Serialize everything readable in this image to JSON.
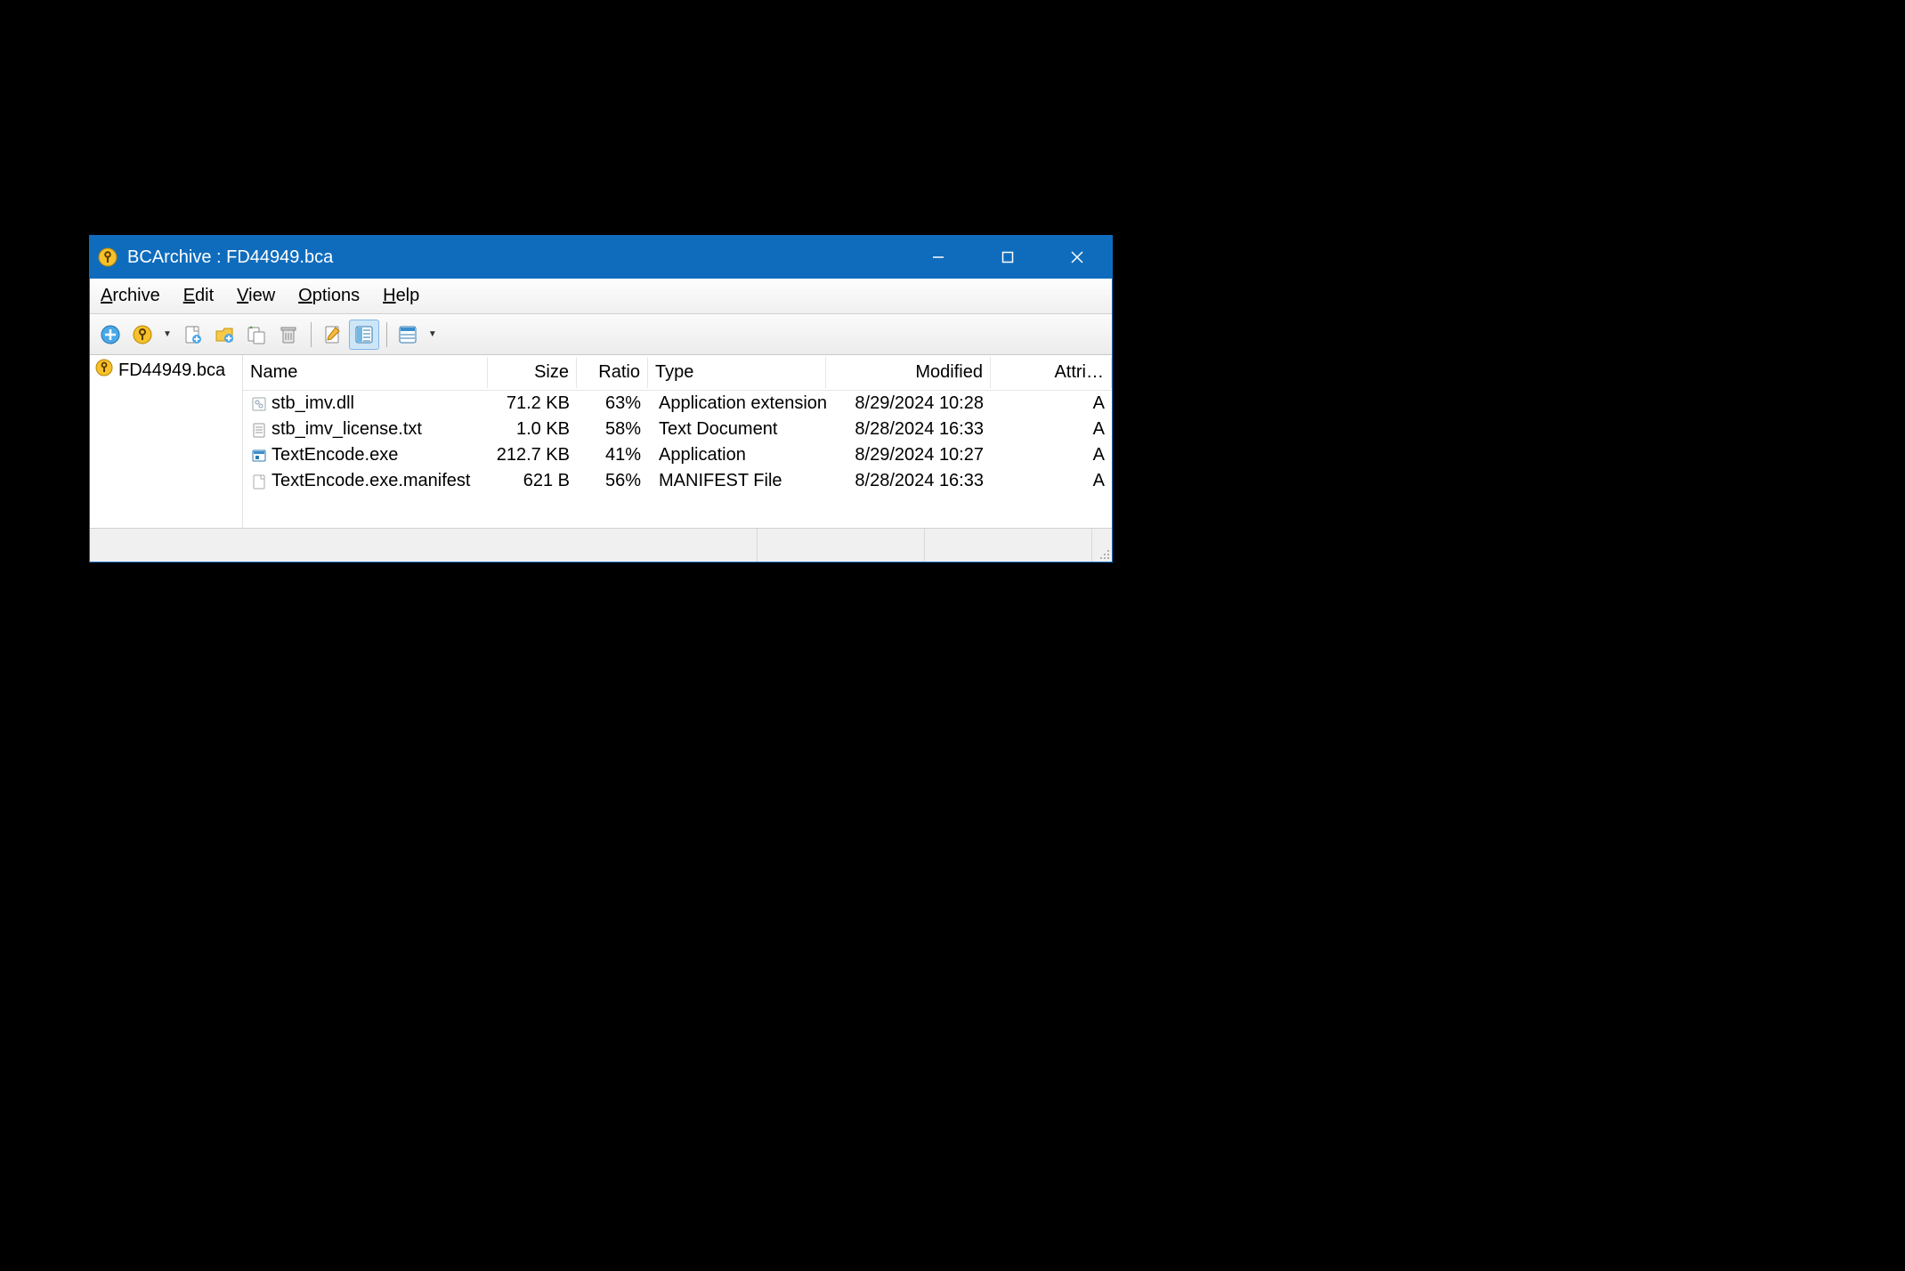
{
  "window": {
    "title": "BCArchive : FD44949.bca"
  },
  "menus": [
    {
      "label": "Archive",
      "hotkey": "A"
    },
    {
      "label": "Edit",
      "hotkey": "E"
    },
    {
      "label": "View",
      "hotkey": "V"
    },
    {
      "label": "Options",
      "hotkey": "O"
    },
    {
      "label": "Help",
      "hotkey": "H"
    }
  ],
  "tree": {
    "root": "FD44949.bca"
  },
  "columns": {
    "name": "Name",
    "size": "Size",
    "ratio": "Ratio",
    "type": "Type",
    "modified": "Modified",
    "attr": "Attri…"
  },
  "files": [
    {
      "icon": "dll",
      "name": "stb_imv.dll",
      "size": "71.2 KB",
      "ratio": "63%",
      "type": "Application extension",
      "modified": "8/29/2024 10:28",
      "attr": "A"
    },
    {
      "icon": "txt",
      "name": "stb_imv_license.txt",
      "size": "1.0 KB",
      "ratio": "58%",
      "type": "Text Document",
      "modified": "8/28/2024 16:33",
      "attr": "A"
    },
    {
      "icon": "exe",
      "name": "TextEncode.exe",
      "size": "212.7 KB",
      "ratio": "41%",
      "type": "Application",
      "modified": "8/29/2024 10:27",
      "attr": "A"
    },
    {
      "icon": "file",
      "name": "TextEncode.exe.manifest",
      "size": "621 B",
      "ratio": "56%",
      "type": "MANIFEST File",
      "modified": "8/28/2024 16:33",
      "attr": "A"
    }
  ]
}
